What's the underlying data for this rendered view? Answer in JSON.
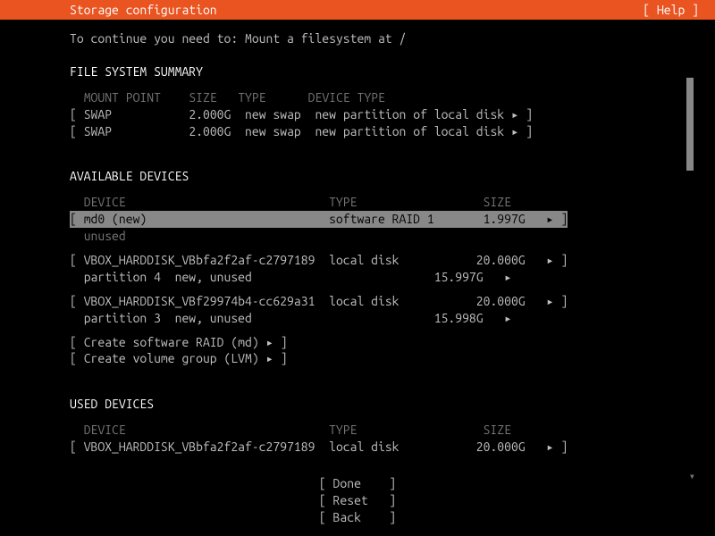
{
  "topbar": {
    "title": "Storage configuration",
    "help": "[ Help ]"
  },
  "instruction": "To continue you need to: Mount a filesystem at /",
  "fs_summary": {
    "title": "FILE SYSTEM SUMMARY",
    "headers": {
      "mount": "MOUNT POINT",
      "size": "SIZE",
      "type": "TYPE",
      "devtype": "DEVICE TYPE"
    },
    "rows": [
      {
        "mount": "SWAP",
        "size": "2.000G",
        "type": "new swap",
        "devtype": "new partition of local disk"
      },
      {
        "mount": "SWAP",
        "size": "2.000G",
        "type": "new swap",
        "devtype": "new partition of local disk"
      }
    ]
  },
  "available": {
    "title": "AVAILABLE DEVICES",
    "headers": {
      "device": "DEVICE",
      "type": "TYPE",
      "size": "SIZE"
    },
    "md0": {
      "name": "md0 (new)",
      "type": "software RAID 1",
      "size": "1.997G",
      "sub": "unused"
    },
    "disk1": {
      "name": "VBOX_HARDDISK_VBbfa2f2af-c2797189",
      "type": "local disk",
      "size": "20.000G",
      "sub": "partition 4  new, unused",
      "subsize": "15.997G"
    },
    "disk2": {
      "name": "VBOX_HARDDISK_VBf29974b4-cc629a31",
      "type": "local disk",
      "size": "20.000G",
      "sub": "partition 3  new, unused",
      "subsize": "15.998G"
    },
    "create_raid": "Create software RAID (md)",
    "create_lvm": "Create volume group (LVM)"
  },
  "used": {
    "title": "USED DEVICES",
    "headers": {
      "device": "DEVICE",
      "type": "TYPE",
      "size": "SIZE"
    },
    "disk1": {
      "name": "VBOX_HARDDISK_VBbfa2f2af-c2797189",
      "type": "local disk",
      "size": "20.000G"
    }
  },
  "buttons": {
    "done": "Done",
    "reset": "Reset",
    "back": "Back"
  },
  "glyph": {
    "arrow": "▸",
    "down": "▾"
  }
}
